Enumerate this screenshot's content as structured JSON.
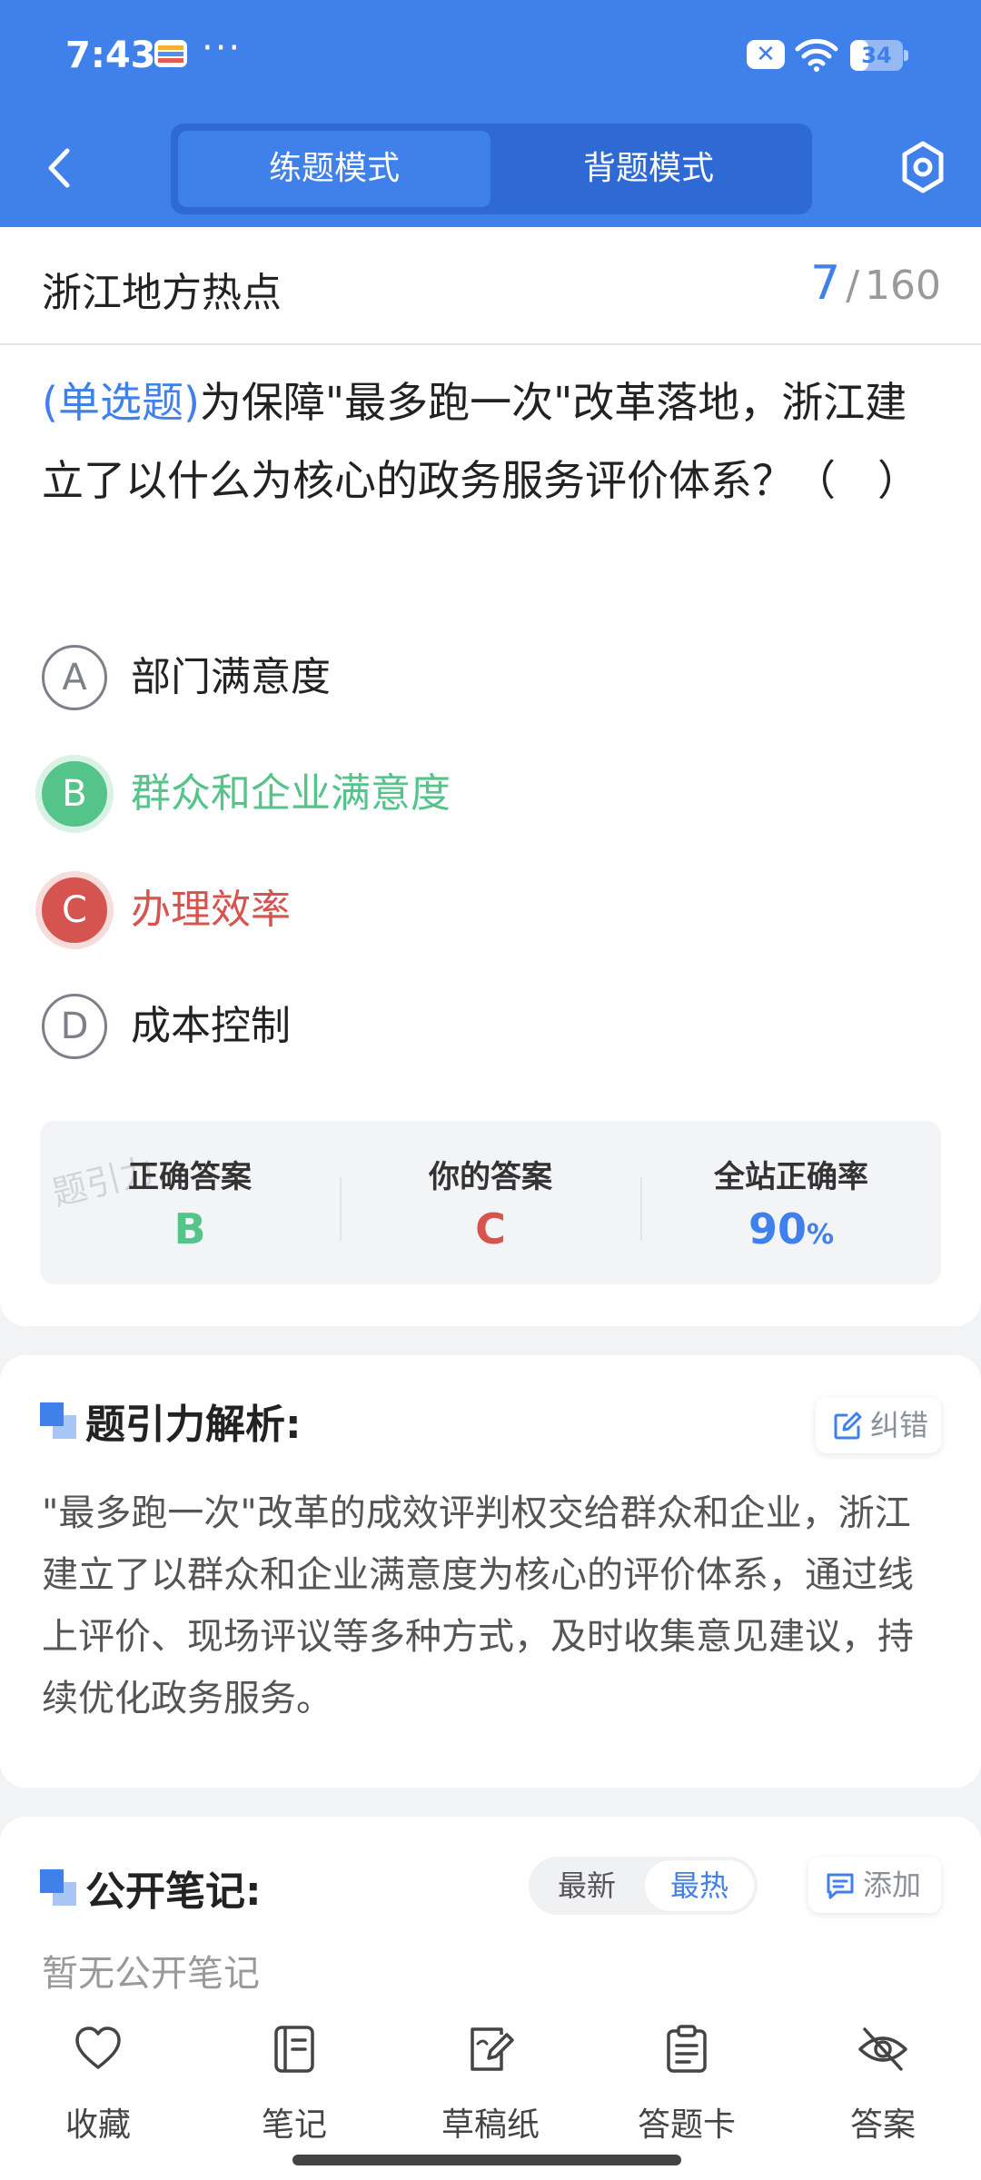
{
  "status_bar": {
    "time": "7:43",
    "more": "···",
    "battery_level": "34",
    "battery_fraction": 0.34
  },
  "nav": {
    "modes": [
      "练题模式",
      "背题模式"
    ],
    "active_mode": "练题模式"
  },
  "question": {
    "category": "浙江地方热点",
    "current": "7",
    "separator": "/",
    "total": "160",
    "type_label": "(单选题)",
    "text": "为保障\"最多跑一次\"改革落地，浙江建立了以什么为核心的政务服务评价体系？（　）",
    "options": [
      {
        "letter": "A",
        "text": "部门满意度",
        "state": "normal"
      },
      {
        "letter": "B",
        "text": "群众和企业满意度",
        "state": "correct"
      },
      {
        "letter": "C",
        "text": "办理效率",
        "state": "wrong"
      },
      {
        "letter": "D",
        "text": "成本控制",
        "state": "normal"
      }
    ]
  },
  "answer_summary": {
    "watermark": "题引力",
    "correct_label": "正确答案",
    "correct_value": "B",
    "yours_label": "你的答案",
    "yours_value": "C",
    "rate_label": "全站正确率",
    "rate_value": "90",
    "rate_unit": "%"
  },
  "analysis": {
    "title": "题引力解析:",
    "report_label": "纠错",
    "text": "\"最多跑一次\"改革的成效评判权交给群众和企业，浙江建立了以群众和企业满意度为核心的评价体系，通过线上评价、现场评议等多种方式，及时收集意见建议，持续优化政务服务。"
  },
  "notes": {
    "title": "公开笔记:",
    "sort_latest": "最新",
    "sort_hottest": "最热",
    "active_sort": "最热",
    "add_label": "添加",
    "empty_text": "暂无公开笔记"
  },
  "bottom_nav": {
    "items": [
      {
        "label": "收藏",
        "icon": "heart-icon"
      },
      {
        "label": "笔记",
        "icon": "notebook-icon"
      },
      {
        "label": "草稿纸",
        "icon": "draft-paper-icon"
      },
      {
        "label": "答题卡",
        "icon": "answer-sheet-icon"
      },
      {
        "label": "答案",
        "icon": "eye-off-icon"
      }
    ]
  },
  "colors": {
    "primary": "#3f80ea",
    "correct": "#55c48a",
    "wrong": "#d65450"
  }
}
